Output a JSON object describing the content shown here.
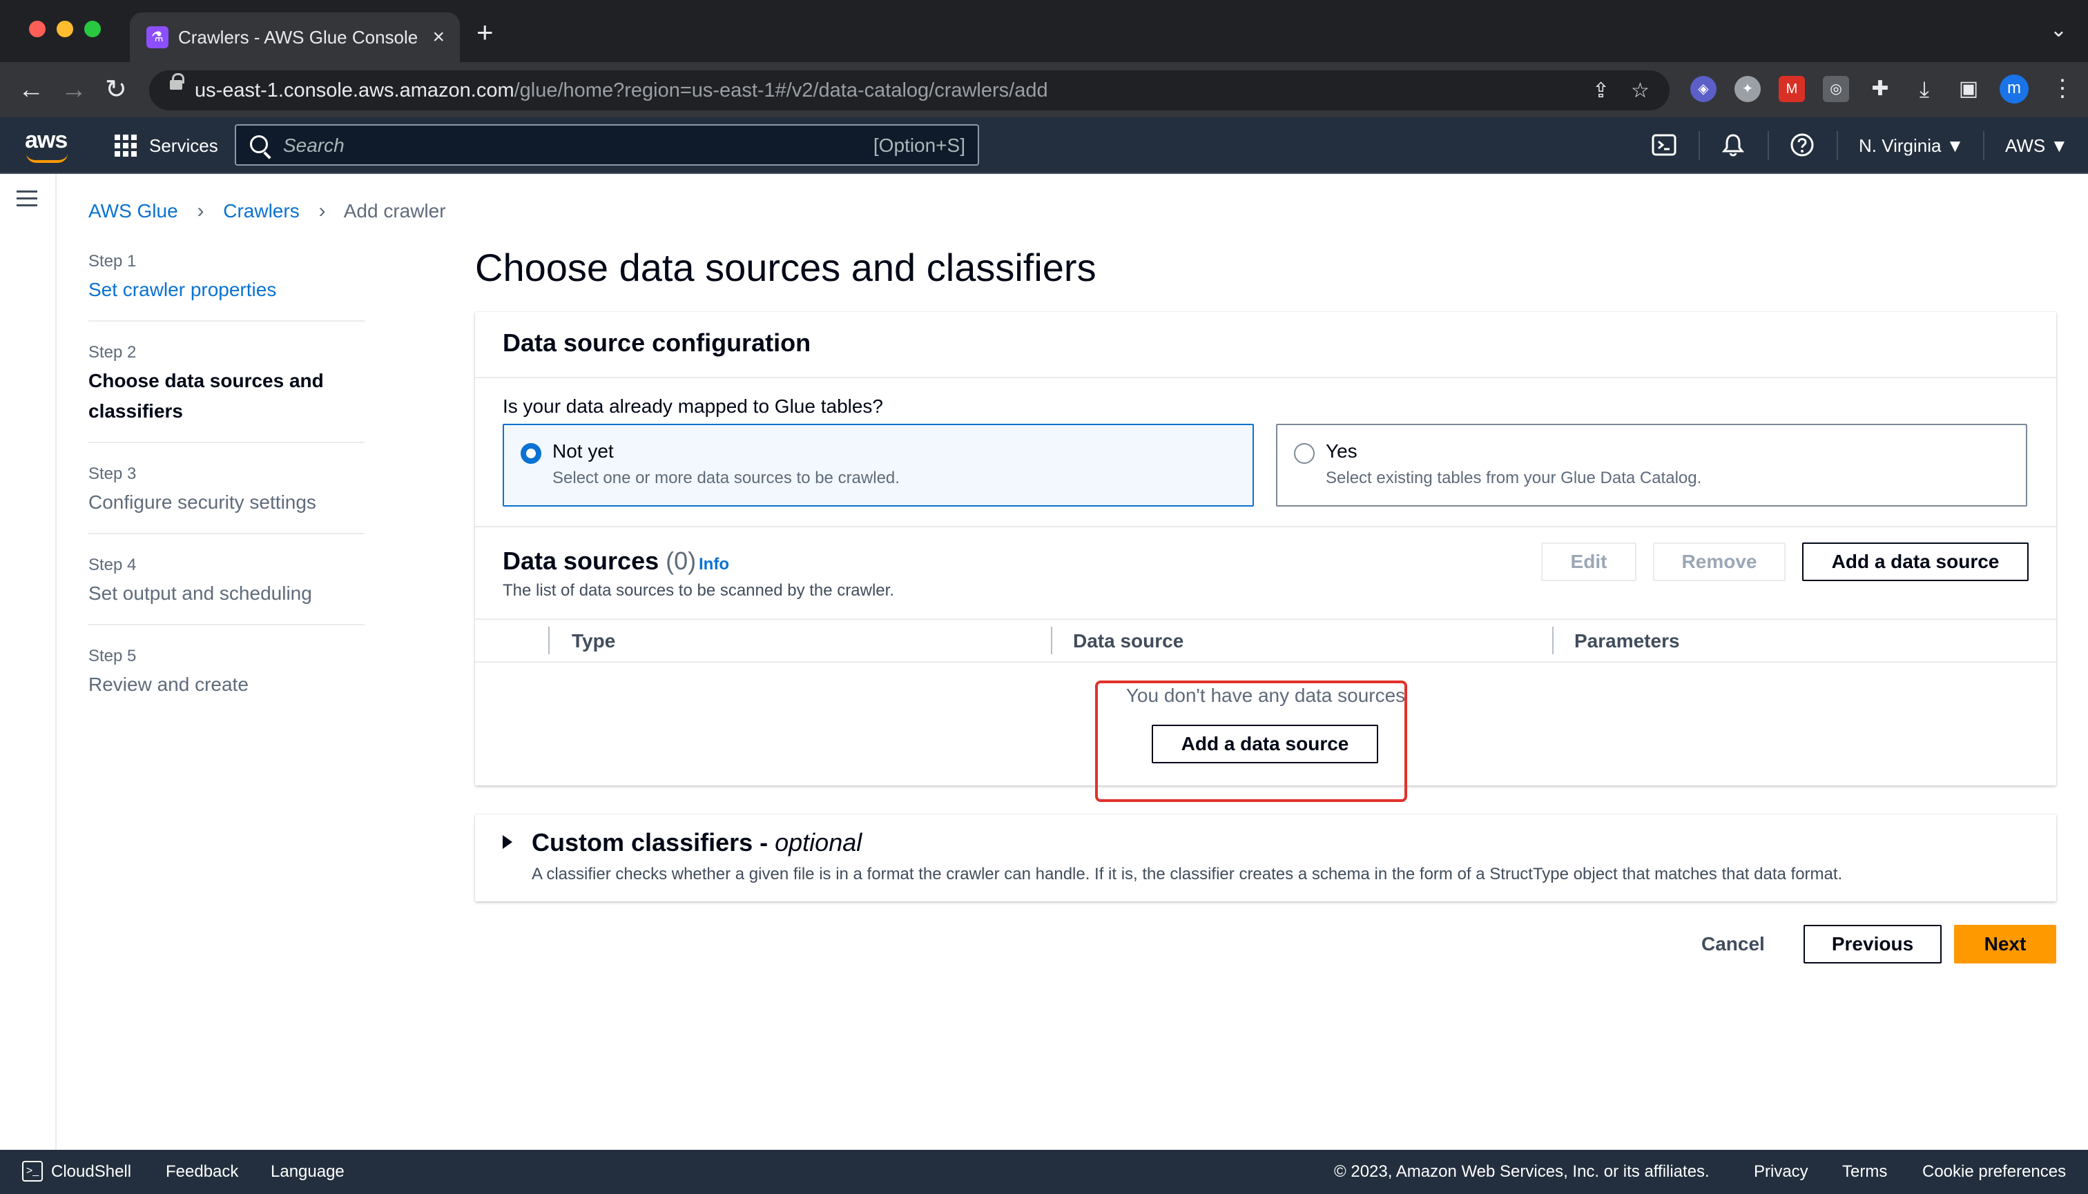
{
  "browser": {
    "tab_title": "Crawlers - AWS Glue Console",
    "tab_close": "×",
    "new_tab": "+",
    "tab_search": "⌄",
    "url_host": "us-east-1.console.aws.amazon.com",
    "url_path": "/glue/home?region=us-east-1#/v2/data-catalog/crawlers/add",
    "profile_initial": "m"
  },
  "header": {
    "logo": "aws",
    "services": "Services",
    "search_placeholder": "Search",
    "search_shortcut": "[Option+S]",
    "region": "N. Virginia ▼",
    "account": "AWS ▼"
  },
  "breadcrumb": {
    "items": [
      "AWS Glue",
      "Crawlers"
    ],
    "current": "Add crawler",
    "separator": "›"
  },
  "steps": [
    {
      "num": "Step 1",
      "label": "Set crawler properties",
      "state": "link"
    },
    {
      "num": "Step 2",
      "label": "Choose data sources and classifiers",
      "state": "active"
    },
    {
      "num": "Step 3",
      "label": "Configure security settings",
      "state": "muted"
    },
    {
      "num": "Step 4",
      "label": "Set output and scheduling",
      "state": "muted"
    },
    {
      "num": "Step 5",
      "label": "Review and create",
      "state": "muted"
    }
  ],
  "main": {
    "title": "Choose data sources and classifiers",
    "config": {
      "header": "Data source configuration",
      "question": "Is your data already mapped to Glue tables?",
      "options": [
        {
          "title": "Not yet",
          "desc": "Select one or more data sources to be crawled.",
          "selected": true
        },
        {
          "title": "Yes",
          "desc": "Select existing tables from your Glue Data Catalog.",
          "selected": false
        }
      ]
    },
    "sources": {
      "title": "Data sources",
      "count": "(0)",
      "info": "Info",
      "desc": "The list of data sources to be scanned by the crawler.",
      "edit": "Edit",
      "remove": "Remove",
      "add": "Add a data source",
      "columns": [
        "Type",
        "Data source",
        "Parameters"
      ],
      "empty_text": "You don't have any data sources",
      "empty_add": "Add a data source"
    },
    "classifiers": {
      "title": "Custom classifiers - ",
      "title_optional": "optional",
      "desc": "A classifier checks whether a given file is in a format the crawler can handle. If it is, the classifier creates a schema in the form of a StructType object that matches that data format."
    },
    "actions": {
      "cancel": "Cancel",
      "previous": "Previous",
      "next": "Next"
    }
  },
  "footer": {
    "cloudshell": "CloudShell",
    "feedback": "Feedback",
    "language": "Language",
    "copyright": "© 2023, Amazon Web Services, Inc. or its affiliates.",
    "privacy": "Privacy",
    "terms": "Terms",
    "cookies": "Cookie preferences"
  },
  "colors": {
    "accent": "#0972d3",
    "primary_button": "#ff9900",
    "header_bg": "#232f3e",
    "annotation": "#e0332b"
  }
}
